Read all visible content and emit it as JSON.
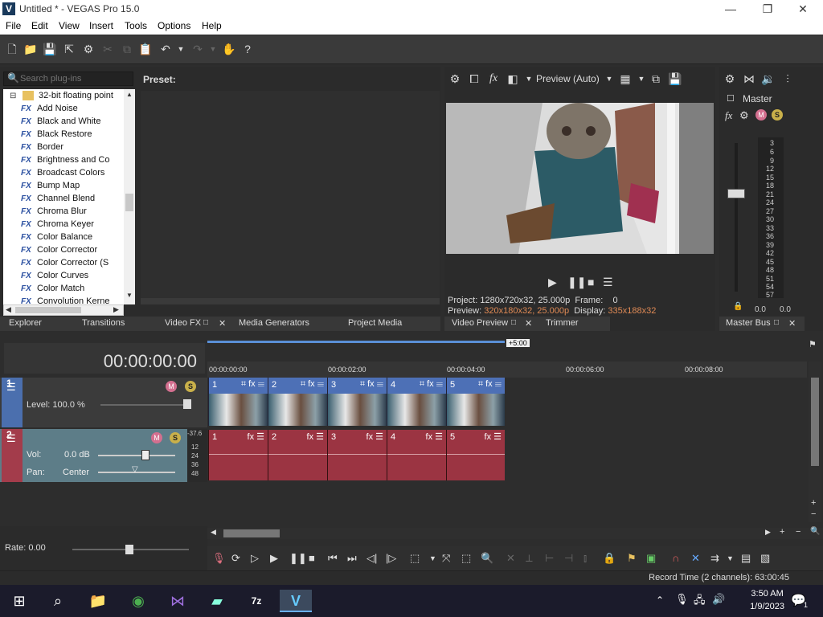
{
  "window": {
    "title": "Untitled * - VEGAS Pro 15.0",
    "app_icon": "V",
    "minimize": "—",
    "maximize": "❐",
    "close": "✕"
  },
  "menu": [
    "File",
    "Edit",
    "View",
    "Insert",
    "Tools",
    "Options",
    "Help"
  ],
  "plugins": {
    "search_placeholder": "Search plug-ins",
    "folder": "32-bit floating point",
    "items": [
      "Add Noise",
      "Black and White",
      "Black Restore",
      "Border",
      "Brightness and Co",
      "Broadcast Colors",
      "Bump Map",
      "Channel Blend",
      "Chroma Blur",
      "Chroma Keyer",
      "Color Balance",
      "Color Corrector",
      "Color Corrector (S",
      "Color Curves",
      "Color Match",
      "Convolution Kerne"
    ],
    "fx_tag": "FX",
    "preset_label": "Preset:"
  },
  "left_tabs": [
    "Explorer",
    "Transitions",
    "Video FX",
    "Media Generators",
    "Project Media"
  ],
  "preview": {
    "mode": "Preview (Auto)",
    "project_label": "Project:",
    "project_value": "1280x720x32, 25.000p",
    "frame_label": "Frame:",
    "frame_value": "0",
    "preview_label": "Preview:",
    "preview_value": "320x180x32, 25.000p",
    "display_label": "Display:",
    "display_value": "335x188x32",
    "tabs": [
      "Video Preview",
      "Trimmer"
    ]
  },
  "master": {
    "label": "Master",
    "scale": [
      "3",
      "6",
      "9",
      "12",
      "15",
      "18",
      "21",
      "24",
      "27",
      "30",
      "33",
      "36",
      "39",
      "42",
      "45",
      "48",
      "51",
      "54",
      "57"
    ],
    "left_level": "0.0",
    "right_level": "0.0",
    "tab": "Master Bus"
  },
  "timeline": {
    "timecode": "00:00:00:00",
    "ruler": [
      "00:00:00:00",
      "00:00:02:00",
      "00:00:04:00",
      "00:00:06:00",
      "00:00:08:00"
    ],
    "loop_marker": "+5:00",
    "track1": {
      "num": "1",
      "level": "Level: 100.0 %"
    },
    "track2": {
      "num": "2",
      "vol_label": "Vol:",
      "vol_value": "0.0 dB",
      "pan_label": "Pan:",
      "pan_value": "Center",
      "meter_top": "-37.6",
      "meter_scale": [
        "12",
        "24",
        "36",
        "48"
      ]
    },
    "video_clips": [
      "1",
      "2",
      "3",
      "4",
      "5"
    ],
    "audio_clips": [
      "1",
      "2",
      "3",
      "4",
      "5"
    ],
    "rate": "Rate: 0.00"
  },
  "status": {
    "record_time": "Record Time (2 channels): 63:00:45"
  },
  "taskbar": {
    "time": "3:50 AM",
    "date": "1/9/2023",
    "notif_count": "1"
  }
}
